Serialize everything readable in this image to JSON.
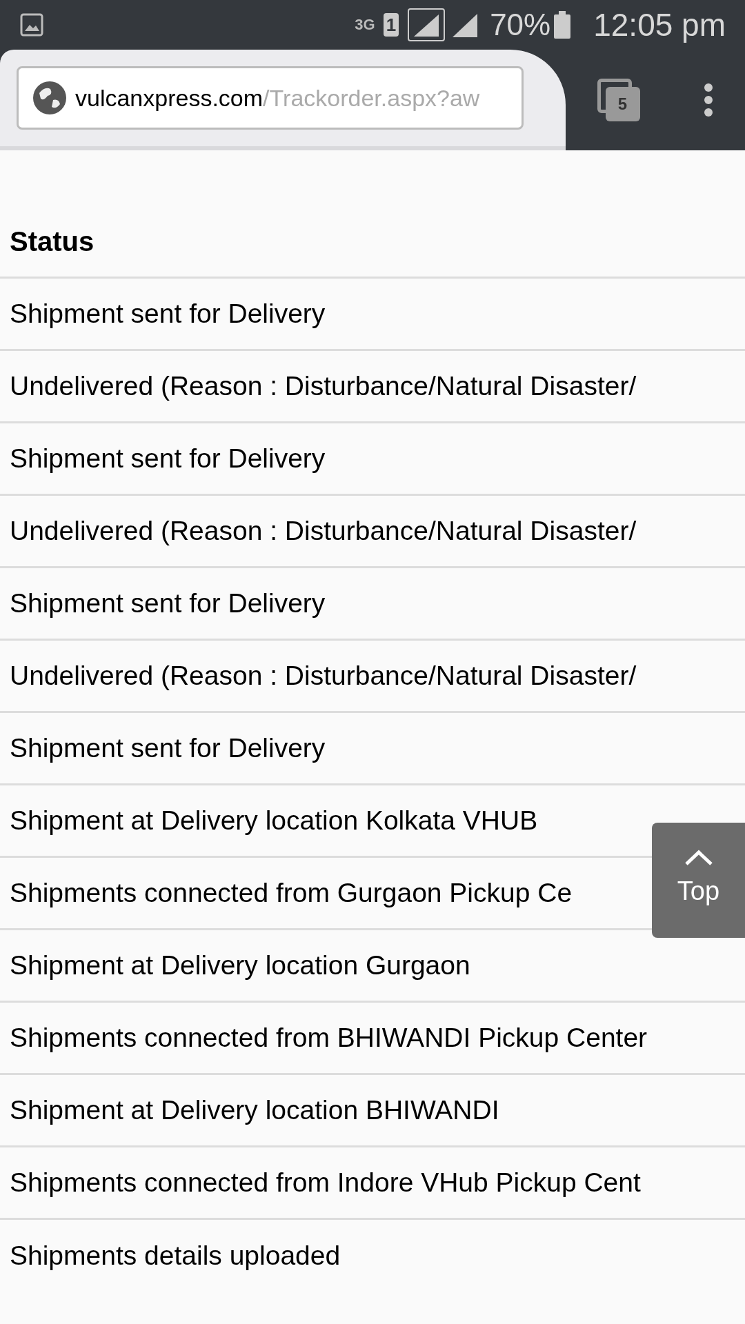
{
  "status_bar": {
    "network": "3G",
    "sim": "1",
    "battery": "70%",
    "time": "12:05 pm"
  },
  "browser": {
    "url_host": "vulcanxpress.com",
    "url_path": "/Trackorder.aspx?aw",
    "tab_count": "5"
  },
  "table": {
    "columns": [
      "Status"
    ],
    "rows": [
      "Shipment sent for Delivery",
      "Undelivered (Reason : Disturbance/Natural Disaster/",
      "Shipment sent for Delivery",
      "Undelivered (Reason : Disturbance/Natural Disaster/",
      "Shipment sent for Delivery",
      "Undelivered (Reason : Disturbance/Natural Disaster/",
      "Shipment sent for Delivery",
      "Shipment at Delivery location Kolkata VHUB",
      "Shipments connected from Gurgaon Pickup Ce",
      "Shipment at Delivery location Gurgaon",
      "Shipments connected from BHIWANDI Pickup Center",
      "Shipment at Delivery location BHIWANDI",
      "Shipments connected from Indore VHub Pickup Cent",
      "Shipments details uploaded"
    ]
  },
  "top_button": {
    "label": "Top"
  }
}
